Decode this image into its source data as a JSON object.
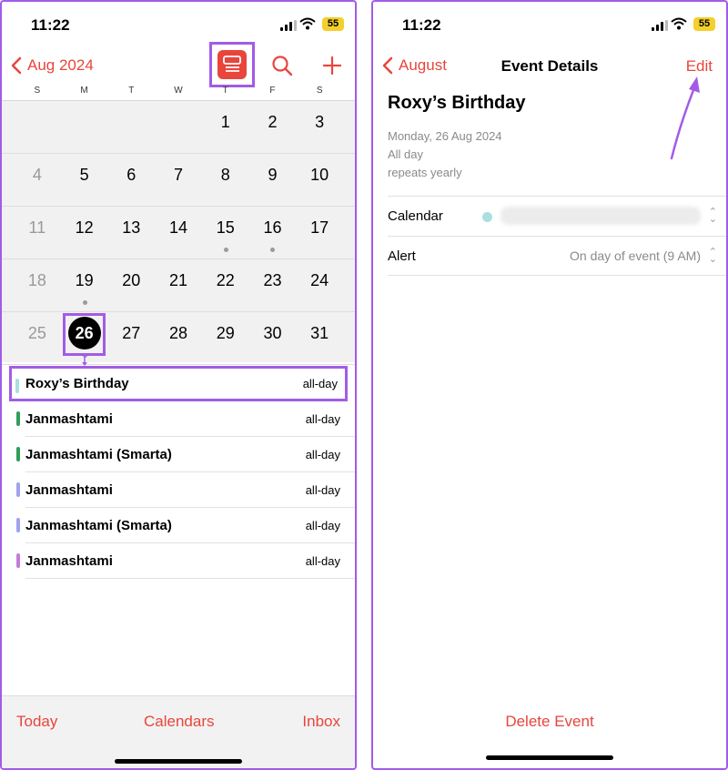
{
  "colors": {
    "accent": "#e8453c",
    "highlight": "#a15ce6"
  },
  "status": {
    "time": "11:22",
    "battery": "55"
  },
  "calendar": {
    "back_label": "Aug 2024",
    "icons": [
      "list-view-icon",
      "search-icon",
      "plus-icon"
    ],
    "weekdays": [
      "S",
      "M",
      "T",
      "W",
      "T",
      "F",
      "S"
    ],
    "weeks": [
      [
        {
          "d": ""
        },
        {
          "d": ""
        },
        {
          "d": ""
        },
        {
          "d": ""
        },
        {
          "d": "1"
        },
        {
          "d": "2"
        },
        {
          "d": "3"
        }
      ],
      [
        {
          "d": "4",
          "other": true
        },
        {
          "d": "5"
        },
        {
          "d": "6"
        },
        {
          "d": "7"
        },
        {
          "d": "8"
        },
        {
          "d": "9"
        },
        {
          "d": "10"
        }
      ],
      [
        {
          "d": "11",
          "other": true
        },
        {
          "d": "12"
        },
        {
          "d": "13"
        },
        {
          "d": "14"
        },
        {
          "d": "15",
          "dot": true
        },
        {
          "d": "16",
          "dot": true
        },
        {
          "d": "17"
        }
      ],
      [
        {
          "d": "18",
          "other": true
        },
        {
          "d": "19",
          "dot": true
        },
        {
          "d": "20"
        },
        {
          "d": "21"
        },
        {
          "d": "22"
        },
        {
          "d": "23"
        },
        {
          "d": "24"
        }
      ],
      [
        {
          "d": "25",
          "other": true
        },
        {
          "d": "26",
          "today": true,
          "dot": true
        },
        {
          "d": "27"
        },
        {
          "d": "28"
        },
        {
          "d": "29"
        },
        {
          "d": "30"
        },
        {
          "d": "31"
        }
      ]
    ],
    "events": [
      {
        "title": "Roxy’s Birthday",
        "time": "all-day",
        "color": "#a8e0e0",
        "highlight": true
      },
      {
        "title": "Janmashtami",
        "time": "all-day",
        "color": "#2e9e5b"
      },
      {
        "title": "Janmashtami (Smarta)",
        "time": "all-day",
        "color": "#2e9e5b"
      },
      {
        "title": "Janmashtami",
        "time": "all-day",
        "color": "#9fa3ee"
      },
      {
        "title": "Janmashtami (Smarta)",
        "time": "all-day",
        "color": "#9fa3ee"
      },
      {
        "title": "Janmashtami",
        "time": "all-day",
        "color": "#c07ddb"
      }
    ],
    "toolbar": {
      "today": "Today",
      "calendars": "Calendars",
      "inbox": "Inbox"
    }
  },
  "details": {
    "back_label": "August",
    "nav_title": "Event Details",
    "edit_label": "Edit",
    "title": "Roxy’s Birthday",
    "date": "Monday, 26 Aug 2024",
    "all_day": "All day",
    "repeats": "repeats yearly",
    "calendar_label": "Calendar",
    "calendar_color": "#a8e0e0",
    "alert_label": "Alert",
    "alert_value": "On day of event (9 AM)",
    "delete_label": "Delete Event"
  }
}
